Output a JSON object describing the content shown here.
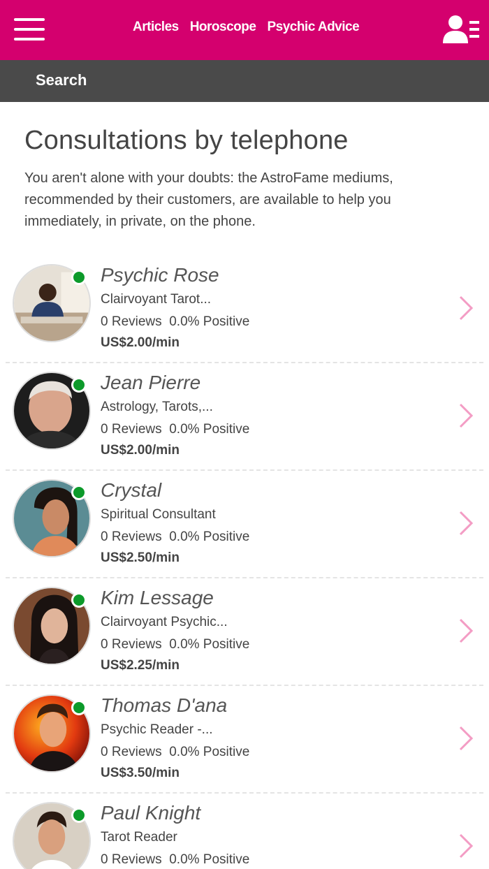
{
  "header": {
    "nav": [
      "Articles",
      "Horoscope",
      "Psychic Advice"
    ],
    "menu_icon": "hamburger-menu-icon",
    "account_icon": "user-account-icon",
    "brand_color": "#d4006e"
  },
  "search": {
    "label": "Search"
  },
  "main": {
    "title": "Consultations by telephone",
    "intro": "You aren't alone with your doubts: the AstroFame mediums, recommended by their customers, are available to help you immediately, in private, on the phone."
  },
  "psychics": [
    {
      "name": "Psychic Rose",
      "specialty": "Clairvoyant Tarot...",
      "reviews": "0 Reviews",
      "positive": "0.0% Positive",
      "price": "US$2.00/min",
      "status": "online"
    },
    {
      "name": "Jean Pierre",
      "specialty": "Astrology, Tarots,...",
      "reviews": "0 Reviews",
      "positive": "0.0% Positive",
      "price": "US$2.00/min",
      "status": "online"
    },
    {
      "name": "Crystal",
      "specialty": "Spiritual Consultant",
      "reviews": "0 Reviews",
      "positive": "0.0% Positive",
      "price": "US$2.50/min",
      "status": "online"
    },
    {
      "name": "Kim Lessage",
      "specialty": "Clairvoyant Psychic...",
      "reviews": "0 Reviews",
      "positive": "0.0% Positive",
      "price": "US$2.25/min",
      "status": "online"
    },
    {
      "name": "Thomas D'ana",
      "specialty": "Psychic Reader -...",
      "reviews": "0 Reviews",
      "positive": "0.0% Positive",
      "price": "US$3.50/min",
      "status": "online"
    },
    {
      "name": "Paul Knight",
      "specialty": "Tarot Reader",
      "reviews": "0 Reviews",
      "positive": "0.0% Positive",
      "price": "",
      "status": "online"
    }
  ],
  "colors": {
    "online": "#0c9a2a",
    "chevron": "#f39cc4",
    "search_bar": "#4a4a4a"
  }
}
